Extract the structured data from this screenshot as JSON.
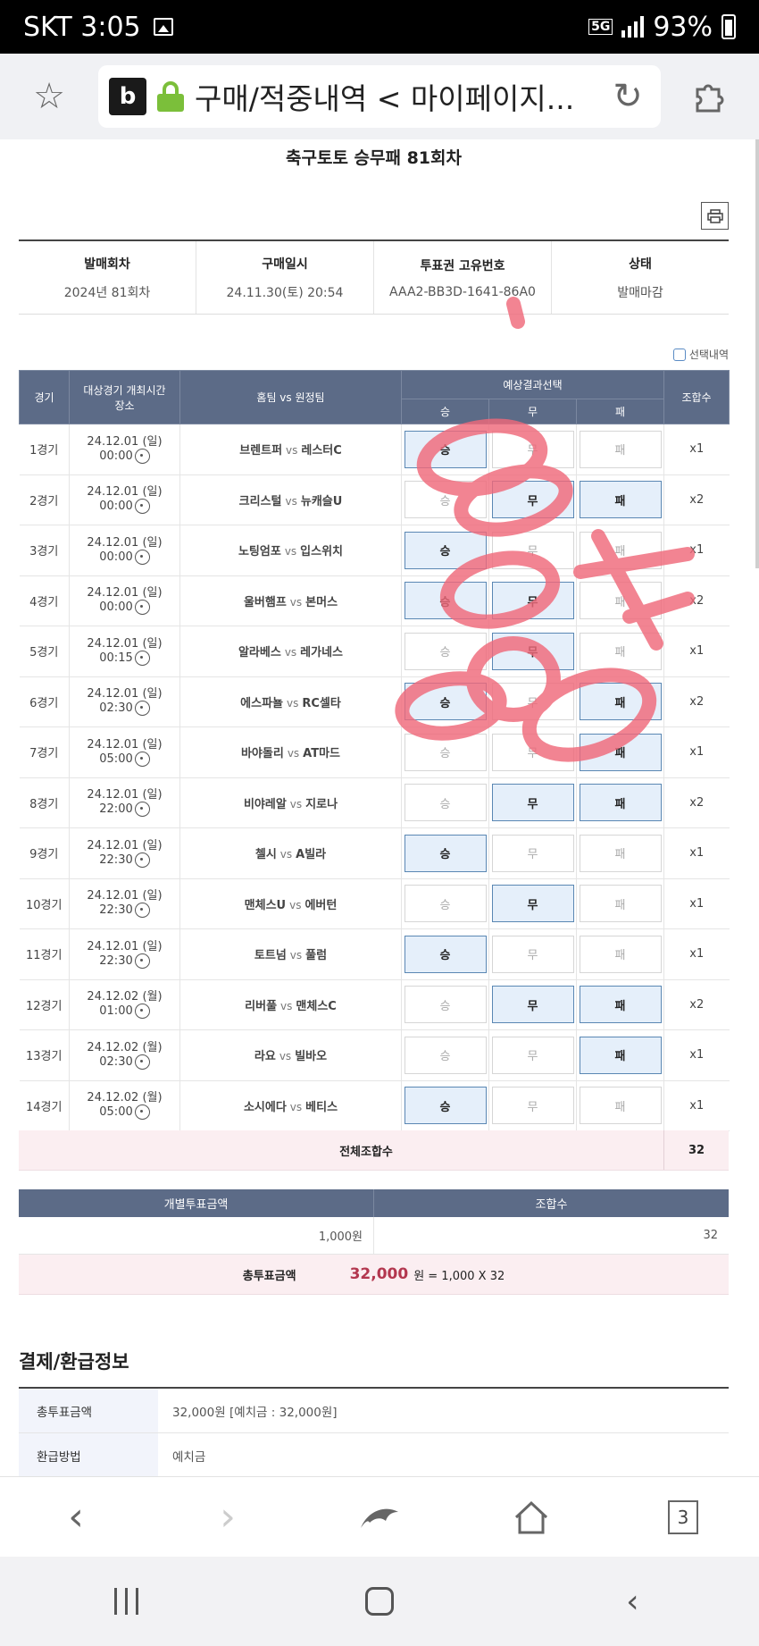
{
  "status_bar": {
    "carrier_time": "SKT 3:05",
    "network": "5G",
    "battery": "93%"
  },
  "browser": {
    "site_badge": "b",
    "url_title": "구매/적중내역 < 마이페이지...",
    "tab_count": "3"
  },
  "round_title": "축구토토 승무패 81회차",
  "info": {
    "headers": [
      "발매회차",
      "구매일시",
      "투표권 고유번호",
      "상태"
    ],
    "values": [
      "2024년 81회차",
      "24.11.30(토) 20:54",
      "AAA2-BB3D-1641-86A0",
      "발매마감"
    ]
  },
  "select_view_label": "선택내역",
  "table": {
    "h_no": "경기",
    "h_time": "대상경기 개최시간",
    "h_place": "장소",
    "h_teams": "홈팀 vs 원정팀",
    "h_pick": "예상결과선택",
    "h_win": "승",
    "h_draw": "무",
    "h_lose": "패",
    "h_comb": "조합수",
    "vs": "vs"
  },
  "games": [
    {
      "no": "1경기",
      "date": "24.12.01 (일)",
      "time": "00:00",
      "home": "브렌트퍼",
      "away": "레스터C",
      "win": "승",
      "draw": "무",
      "lose": "패",
      "sel": [
        true,
        false,
        false
      ],
      "comb": "x1"
    },
    {
      "no": "2경기",
      "date": "24.12.01 (일)",
      "time": "00:00",
      "home": "크리스털",
      "away": "뉴캐슬U",
      "win": "승",
      "draw": "무",
      "lose": "패",
      "sel": [
        false,
        true,
        true
      ],
      "comb": "x2"
    },
    {
      "no": "3경기",
      "date": "24.12.01 (일)",
      "time": "00:00",
      "home": "노팅엄포",
      "away": "입스위치",
      "win": "승",
      "draw": "무",
      "lose": "패",
      "sel": [
        true,
        false,
        false
      ],
      "comb": "x1"
    },
    {
      "no": "4경기",
      "date": "24.12.01 (일)",
      "time": "00:00",
      "home": "울버햄프",
      "away": "본머스",
      "win": "승",
      "draw": "무",
      "lose": "패",
      "sel": [
        true,
        true,
        false
      ],
      "comb": "x2"
    },
    {
      "no": "5경기",
      "date": "24.12.01 (일)",
      "time": "00:15",
      "home": "알라베스",
      "away": "레가네스",
      "win": "승",
      "draw": "무",
      "lose": "패",
      "sel": [
        false,
        true,
        false
      ],
      "comb": "x1"
    },
    {
      "no": "6경기",
      "date": "24.12.01 (일)",
      "time": "02:30",
      "home": "에스파뇰",
      "away": "RC셀타",
      "win": "승",
      "draw": "무",
      "lose": "패",
      "sel": [
        true,
        false,
        true
      ],
      "comb": "x2"
    },
    {
      "no": "7경기",
      "date": "24.12.01 (일)",
      "time": "05:00",
      "home": "바야돌리",
      "away": "AT마드",
      "win": "승",
      "draw": "무",
      "lose": "패",
      "sel": [
        false,
        false,
        true
      ],
      "comb": "x1"
    },
    {
      "no": "8경기",
      "date": "24.12.01 (일)",
      "time": "22:00",
      "home": "비야레알",
      "away": "지로나",
      "win": "승",
      "draw": "무",
      "lose": "패",
      "sel": [
        false,
        true,
        true
      ],
      "comb": "x2"
    },
    {
      "no": "9경기",
      "date": "24.12.01 (일)",
      "time": "22:30",
      "home": "첼시",
      "away": "A빌라",
      "win": "승",
      "draw": "무",
      "lose": "패",
      "sel": [
        true,
        false,
        false
      ],
      "comb": "x1"
    },
    {
      "no": "10경기",
      "date": "24.12.01 (일)",
      "time": "22:30",
      "home": "맨체스U",
      "away": "에버턴",
      "win": "승",
      "draw": "무",
      "lose": "패",
      "sel": [
        false,
        true,
        false
      ],
      "comb": "x1"
    },
    {
      "no": "11경기",
      "date": "24.12.01 (일)",
      "time": "22:30",
      "home": "토트넘",
      "away": "풀럼",
      "win": "승",
      "draw": "무",
      "lose": "패",
      "sel": [
        true,
        false,
        false
      ],
      "comb": "x1"
    },
    {
      "no": "12경기",
      "date": "24.12.02 (월)",
      "time": "01:00",
      "home": "리버풀",
      "away": "맨체스C",
      "win": "승",
      "draw": "무",
      "lose": "패",
      "sel": [
        false,
        true,
        true
      ],
      "comb": "x2"
    },
    {
      "no": "13경기",
      "date": "24.12.02 (월)",
      "time": "02:30",
      "home": "라요",
      "away": "빌바오",
      "win": "승",
      "draw": "무",
      "lose": "패",
      "sel": [
        false,
        false,
        true
      ],
      "comb": "x1"
    },
    {
      "no": "14경기",
      "date": "24.12.02 (월)",
      "time": "05:00",
      "home": "소시에다",
      "away": "베티스",
      "win": "승",
      "draw": "무",
      "lose": "패",
      "sel": [
        true,
        false,
        false
      ],
      "comb": "x1"
    }
  ],
  "total": {
    "label": "전체조합수",
    "value": "32"
  },
  "amount": {
    "h_unit": "개별투표금액",
    "h_comb": "조합수",
    "unit": "1,000원",
    "comb": "32",
    "total_label": "총투표금액",
    "total_value": "32,000",
    "total_formula": "원 = 1,000 X 32"
  },
  "refund": {
    "title": "결제/환급정보",
    "rows": [
      {
        "label": "총투표금액",
        "value": "32,000원 [예치금 : 32,000원]"
      },
      {
        "label": "환급방법",
        "value": "예치금"
      }
    ]
  },
  "colors": {
    "header": "#5c6b87",
    "selected": "#e5effa",
    "total_bg": "#fbeef1",
    "scribble": "#f06a7a"
  }
}
